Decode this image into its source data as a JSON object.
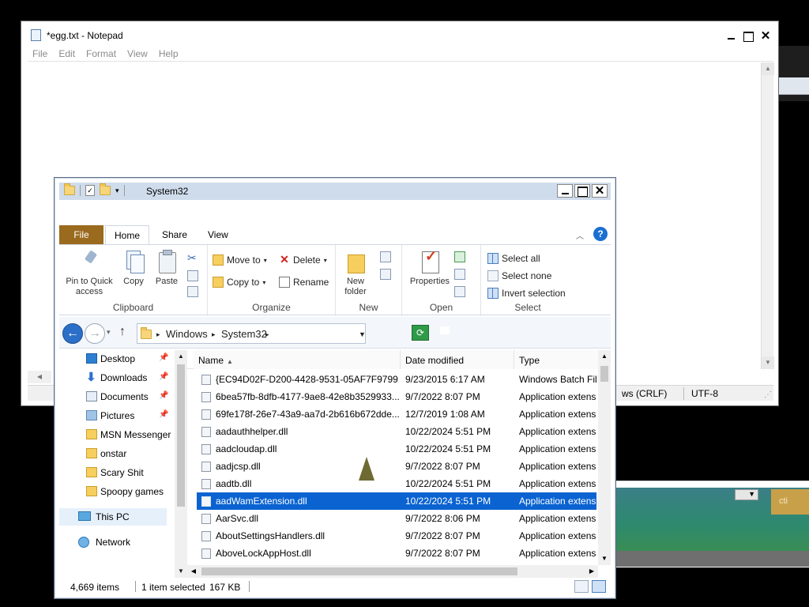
{
  "background": {
    "fragment_status": "ws (CRLF)",
    "dropdown_arrow": "▼",
    "panel_button": "cti"
  },
  "notepad": {
    "title": "*egg.txt - Notepad",
    "menu": [
      "File",
      "Edit",
      "Format",
      "View",
      "Help"
    ],
    "status": {
      "line_endings": "ws (CRLF)",
      "encoding": "UTF-8"
    }
  },
  "explorer": {
    "title": "System32",
    "tabs": {
      "file": "File",
      "home": "Home",
      "share": "Share",
      "view": "View"
    },
    "ribbon": {
      "clipboard": {
        "label": "Clipboard",
        "pin": "Pin to Quick access",
        "copy": "Copy",
        "paste": "Paste"
      },
      "organize": {
        "label": "Organize",
        "move_to": "Move to",
        "copy_to": "Copy to",
        "delete": "Delete",
        "rename": "Rename"
      },
      "new": {
        "label": "New",
        "new_folder": "New folder"
      },
      "open": {
        "label": "Open",
        "properties": "Properties"
      },
      "select": {
        "label": "Select",
        "select_all": "Select all",
        "select_none": "Select none",
        "invert": "Invert selection"
      }
    },
    "address": {
      "crumbs": [
        "Windows",
        "System32"
      ]
    },
    "nav": {
      "quick": [
        {
          "label": "Desktop",
          "icon": "desktop-icon",
          "pinned": true
        },
        {
          "label": "Downloads",
          "icon": "downloads-icon",
          "pinned": true
        },
        {
          "label": "Documents",
          "icon": "documents-icon",
          "pinned": true
        },
        {
          "label": "Pictures",
          "icon": "pictures-icon",
          "pinned": true
        },
        {
          "label": "MSN Messenger",
          "icon": "folder-icon",
          "pinned": false
        },
        {
          "label": "onstar",
          "icon": "folder-icon",
          "pinned": false
        },
        {
          "label": "Scary Shit",
          "icon": "folder-icon",
          "pinned": false
        },
        {
          "label": "Spoopy games",
          "icon": "folder-icon",
          "pinned": false
        }
      ],
      "this_pc": "This PC",
      "network": "Network"
    },
    "columns": {
      "name": "Name",
      "date": "Date modified",
      "type": "Type"
    },
    "files": [
      {
        "name": "{EC94D02F-D200-4428-9531-05AF7F9799...",
        "date": "9/23/2015 6:17 AM",
        "type": "Windows Batch File",
        "selected": false
      },
      {
        "name": "6bea57fb-8dfb-4177-9ae8-42e8b3529933...",
        "date": "9/7/2022 8:07 PM",
        "type": "Application extension",
        "selected": false
      },
      {
        "name": "69fe178f-26e7-43a9-aa7d-2b616b672dde...",
        "date": "12/7/2019 1:08 AM",
        "type": "Application extension",
        "selected": false
      },
      {
        "name": "aadauthhelper.dll",
        "date": "10/22/2024 5:51 PM",
        "type": "Application extension",
        "selected": false
      },
      {
        "name": "aadcloudap.dll",
        "date": "10/22/2024 5:51 PM",
        "type": "Application extension",
        "selected": false
      },
      {
        "name": "aadjcsp.dll",
        "date": "9/7/2022 8:07 PM",
        "type": "Application extension",
        "selected": false
      },
      {
        "name": "aadtb.dll",
        "date": "10/22/2024 5:51 PM",
        "type": "Application extension",
        "selected": false
      },
      {
        "name": "aadWamExtension.dll",
        "date": "10/22/2024 5:51 PM",
        "type": "Application extension",
        "selected": true
      },
      {
        "name": "AarSvc.dll",
        "date": "9/7/2022 8:06 PM",
        "type": "Application extension",
        "selected": false
      },
      {
        "name": "AboutSettingsHandlers.dll",
        "date": "9/7/2022 8:07 PM",
        "type": "Application extension",
        "selected": false
      },
      {
        "name": "AboveLockAppHost.dll",
        "date": "9/7/2022 8:07 PM",
        "type": "Application extension",
        "selected": false
      }
    ],
    "status": {
      "count": "4,669 items",
      "selected": "1 item selected",
      "size": "167 KB"
    }
  }
}
